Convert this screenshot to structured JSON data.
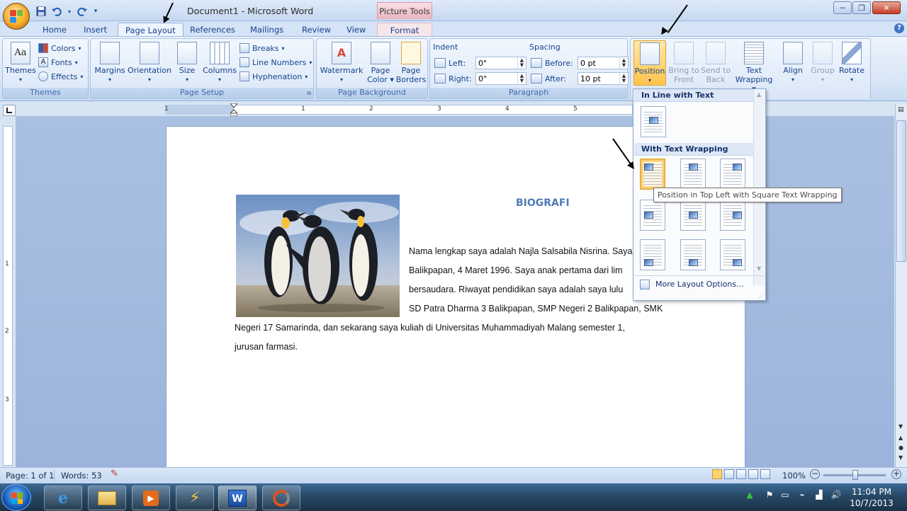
{
  "window": {
    "title": "Document1 - Microsoft Word",
    "context_tab_group": "Picture Tools",
    "minimize": "─",
    "maximize": "❐",
    "close": "✕"
  },
  "tabs": [
    {
      "label": "Home",
      "active": false
    },
    {
      "label": "Insert",
      "active": false
    },
    {
      "label": "Page Layout",
      "active": true
    },
    {
      "label": "References",
      "active": false
    },
    {
      "label": "Mailings",
      "active": false
    },
    {
      "label": "Review",
      "active": false
    },
    {
      "label": "View",
      "active": false
    },
    {
      "label": "Format",
      "active": false,
      "context": true
    }
  ],
  "ribbon": {
    "themes": {
      "themes_label": "Themes",
      "colors": "Colors",
      "fonts": "Fonts",
      "effects": "Effects",
      "group": "Themes"
    },
    "page_setup": {
      "margins": "Margins",
      "orientation": "Orientation",
      "size": "Size",
      "columns": "Columns",
      "breaks": "Breaks",
      "line_numbers": "Line Numbers",
      "hyphenation": "Hyphenation",
      "group": "Page Setup"
    },
    "page_background": {
      "watermark": "Watermark",
      "page_color_1": "Page",
      "page_color_2": "Color",
      "page_borders_1": "Page",
      "page_borders_2": "Borders",
      "group": "Page Background"
    },
    "paragraph": {
      "indent_title": "Indent",
      "left_label": "Left:",
      "left_value": "0\"",
      "right_label": "Right:",
      "right_value": "0\"",
      "spacing_title": "Spacing",
      "before_label": "Before:",
      "before_value": "0 pt",
      "after_label": "After:",
      "after_value": "10 pt",
      "group": "Paragraph"
    },
    "arrange": {
      "position": "Position",
      "bring_to_front_1": "Bring to",
      "bring_to_front_2": "Front",
      "send_to_back_1": "Send to",
      "send_to_back_2": "Back",
      "text_wrapping_1": "Text",
      "text_wrapping_2": "Wrapping",
      "align": "Align",
      "group_btn": "Group",
      "rotate": "Rotate"
    }
  },
  "position_menu": {
    "section_inline": "In Line with Text",
    "section_wrapping": "With Text Wrapping",
    "selected_index": 0,
    "tooltip": "Position in Top Left with Square Text Wrapping",
    "more_options": "More Layout Options..."
  },
  "document": {
    "title": "BIOGRAFI",
    "lines": [
      "Nama lengkap saya adalah  Najla Salsabila Nisrina. Saya",
      "Balikpapan, 4 Maret 1996.  Saya anak pertama dari lim",
      "bersaudara. Riwayat pendidikan saya adalah saya lulu",
      "SD Patra Dharma 3 Balikpapan, SMP Negeri 2 Balikpapan, SMK",
      "Negeri 17 Samarinda, dan sekarang saya kuliah di Universitas Muhammadiyah Malang semester  1,",
      "jurusan farmasi."
    ]
  },
  "ruler_numbers": [
    "1",
    "1",
    "2",
    "3",
    "4",
    "5"
  ],
  "vruler_numbers": [
    "1",
    "2",
    "3"
  ],
  "status": {
    "page": "Page: 1 of 1",
    "words": "Words: 53",
    "zoom": "100%"
  },
  "taskbar": {
    "time": "11:04 PM",
    "date": "10/7/2013"
  }
}
